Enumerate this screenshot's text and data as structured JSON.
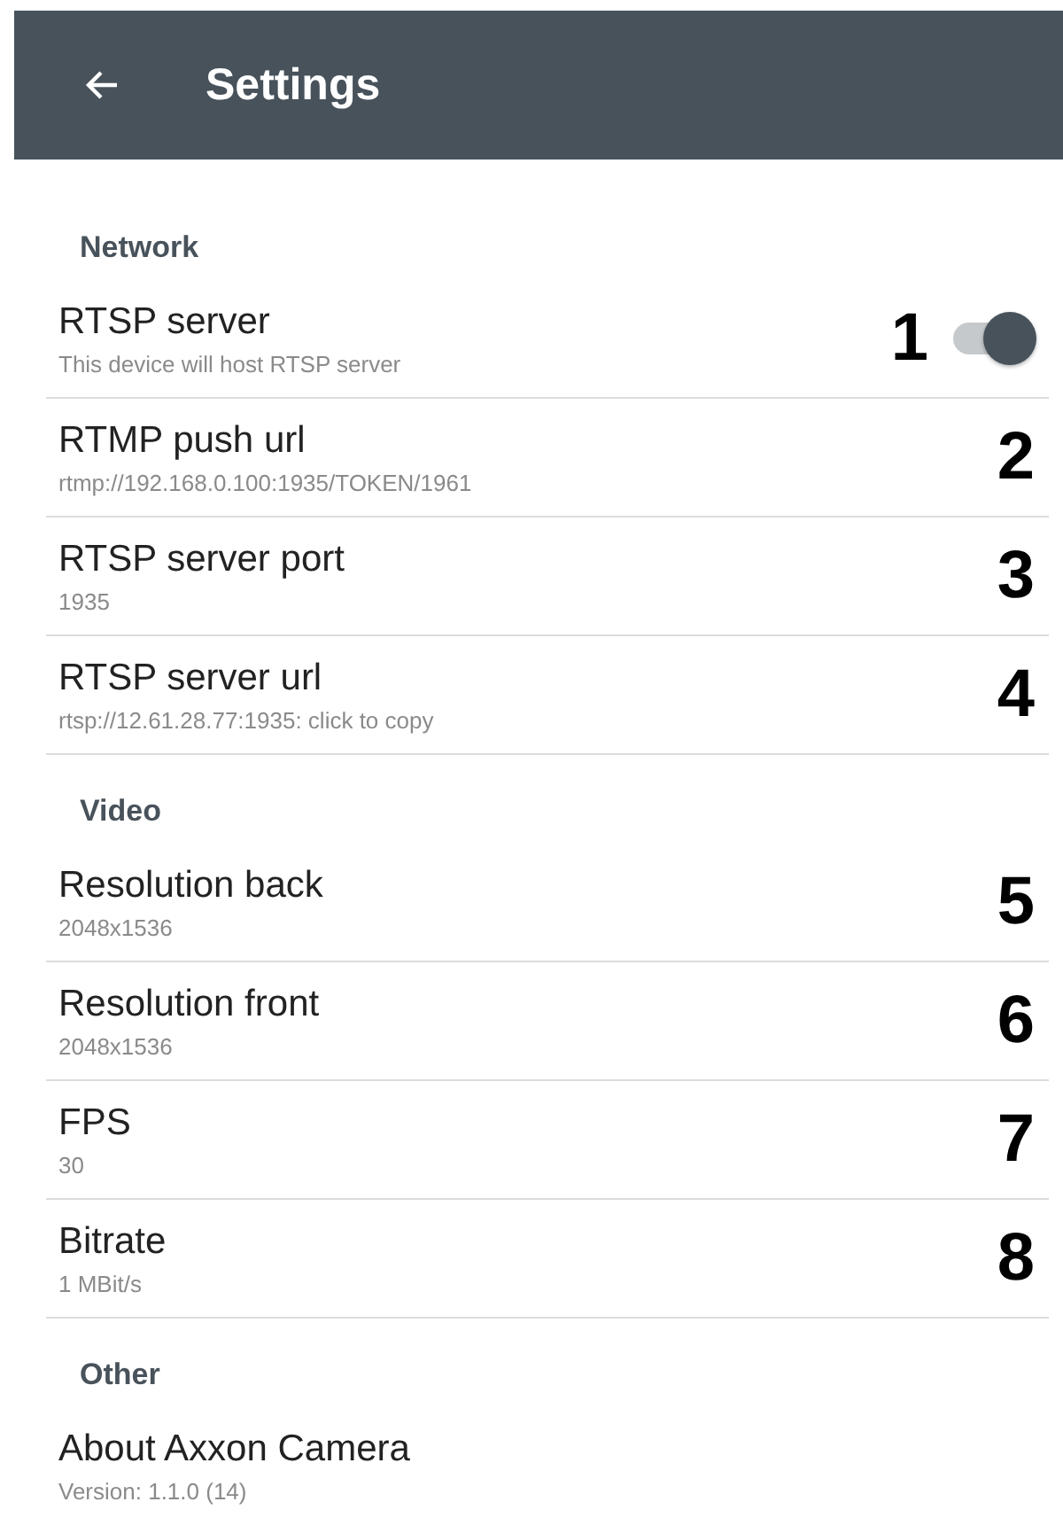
{
  "app_bar": {
    "title": "Settings"
  },
  "sections": [
    {
      "heading": "Network",
      "items": [
        {
          "kind": "switch",
          "title": "RTSP server",
          "summary": "This device will host RTSP server",
          "on": true,
          "callout": "1"
        },
        {
          "kind": "plain",
          "title": "RTMP push url",
          "summary": "rtmp://192.168.0.100:1935/TOKEN/1961",
          "callout": "2"
        },
        {
          "kind": "plain",
          "title": "RTSP server port",
          "summary": "1935",
          "callout": "3"
        },
        {
          "kind": "plain",
          "title": "RTSP server url",
          "summary": "rtsp://12.61.28.77:1935: click to copy",
          "callout": "4"
        }
      ]
    },
    {
      "heading": "Video",
      "items": [
        {
          "kind": "plain",
          "title": "Resolution back",
          "summary": "2048x1536",
          "callout": "5"
        },
        {
          "kind": "plain",
          "title": "Resolution front",
          "summary": "2048x1536",
          "callout": "6"
        },
        {
          "kind": "plain",
          "title": "FPS",
          "summary": "30",
          "callout": "7"
        },
        {
          "kind": "plain",
          "title": "Bitrate",
          "summary": "1 MBit/s",
          "callout": "8"
        }
      ]
    },
    {
      "heading": "Other",
      "items": [
        {
          "kind": "info",
          "title": "About Axxon Camera",
          "summary": "Version: 1.1.0 (14)"
        }
      ]
    }
  ]
}
